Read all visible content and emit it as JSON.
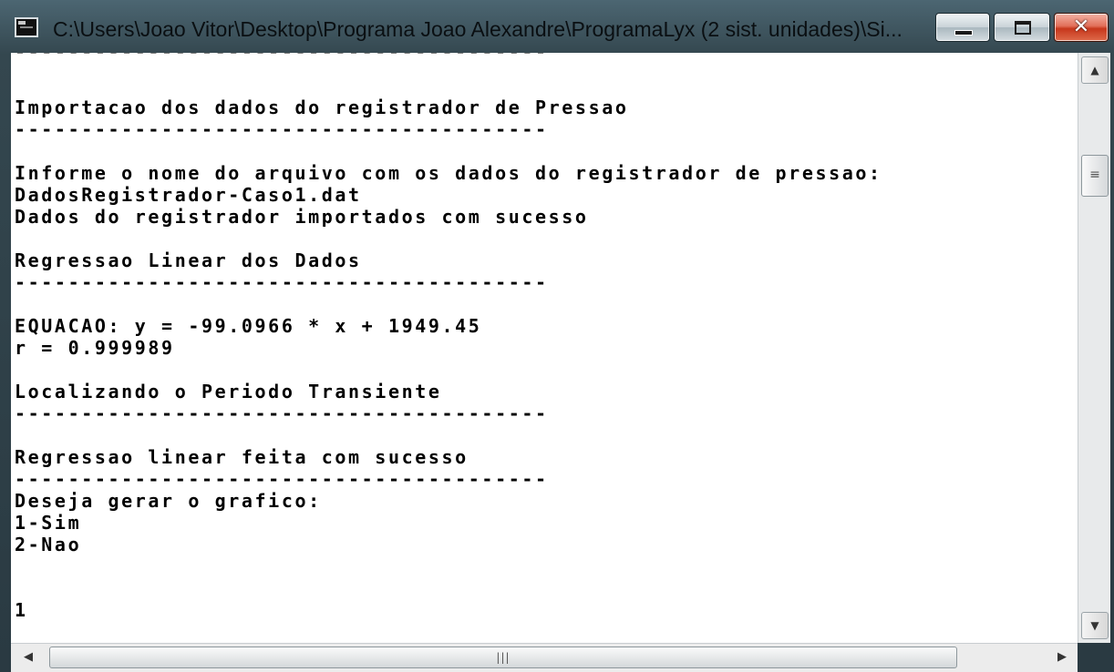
{
  "window": {
    "title": "C:\\Users\\Joao Vitor\\Desktop\\Programa Joao Alexandre\\ProgramaLyx (2 sist. unidades)\\Si...",
    "minimize_label": "",
    "maximize_label": "",
    "close_label": "✕"
  },
  "console": {
    "lines": [
      "----------------------------------------",
      "",
      "Importacao dos dados do registrador de Pressao",
      "----------------------------------------",
      "",
      "Informe o nome do arquivo com os dados do registrador de pressao:",
      "DadosRegistrador-Caso1.dat",
      "Dados do registrador importados com sucesso",
      "",
      "Regressao Linear dos Dados",
      "----------------------------------------",
      "",
      "EQUACAO: y = -99.0966 * x + 1949.45",
      "r = 0.999989",
      "",
      "Localizando o Periodo Transiente",
      "----------------------------------------",
      "",
      "Regressao linear feita com sucesso",
      "----------------------------------------",
      "Deseja gerar o grafico:",
      "1-Sim",
      "2-Nao",
      "",
      "",
      "1"
    ]
  },
  "scrollbars": {
    "up_arrow": "▲",
    "down_arrow": "▼",
    "left_arrow": "◀",
    "right_arrow": "▶",
    "vertical_grip": "≡",
    "horizontal_grip": "|||"
  }
}
